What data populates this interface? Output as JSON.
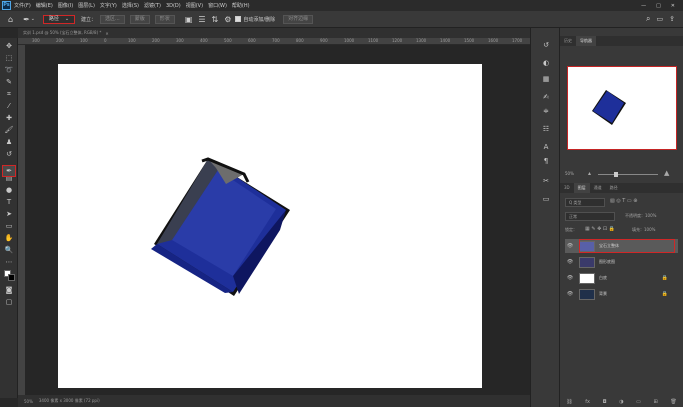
{
  "menubar": {
    "logo": "Ps",
    "items": [
      "文件(F)",
      "编辑(E)",
      "图像(I)",
      "图层(L)",
      "文字(Y)",
      "选择(S)",
      "滤镜(T)",
      "3D(D)",
      "视图(V)",
      "窗口(W)",
      "帮助(H)"
    ],
    "window_controls": [
      "—",
      "□",
      "✕"
    ]
  },
  "options": {
    "mode_value": "路径",
    "make_label": "建立：",
    "selection_btn": "选区...",
    "mask_btn": "蒙版",
    "shape_btn": "形状",
    "auto_label": "自动添加/删除",
    "align_btn": "对齐边缘"
  },
  "document": {
    "tab_title": "实训 1.psd @ 50% (宝石立整体, RGB/8) *",
    "status_zoom": "50%",
    "status_info": "3400 像素 x 3000 像素 (72 ppi)"
  },
  "ruler": {
    "ticks": [
      "300",
      "200",
      "100",
      "0",
      "100",
      "200",
      "300",
      "400",
      "500",
      "600",
      "700",
      "800",
      "900",
      "1000",
      "1100",
      "1200",
      "1300",
      "1400",
      "1500",
      "1600",
      "1700"
    ]
  },
  "panels": {
    "top_tabs": [
      "历史",
      "导航器"
    ],
    "zoom_value": "50%",
    "layer_tabs": [
      "3D",
      "图层",
      "通道",
      "路径"
    ],
    "filter_label": "Q 类型",
    "blend_mode": "正常",
    "opacity_label": "不透明度：100%",
    "lock_label": "锁定：",
    "fill_label": "填充：100%",
    "layers": [
      {
        "name": "宝石立整体",
        "selected": true
      },
      {
        "name": "图形底图",
        "selected": false
      },
      {
        "name": "白底",
        "selected": false
      },
      {
        "name": "背景",
        "selected": false
      }
    ]
  },
  "colors": {
    "accent_red": "#d02727",
    "gem_blue": "#1e2f9a"
  }
}
